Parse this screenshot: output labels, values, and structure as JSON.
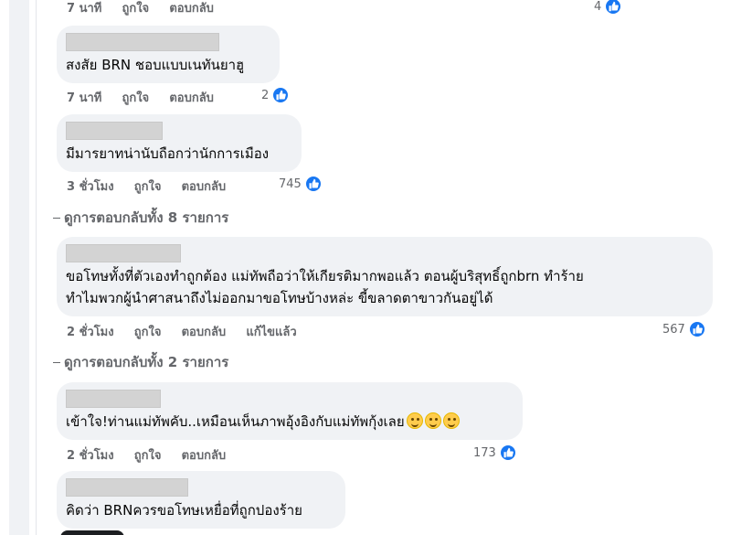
{
  "comments": [
    {
      "id": "c0",
      "text": "",
      "actions": {
        "time": "7 นาที",
        "like": "ถูกใจ",
        "reply": "ตอบกลับ",
        "edited": ""
      },
      "likes": "4"
    },
    {
      "id": "c1",
      "text": "สงสัย BRN ชอบแบบเนทันยาฮู",
      "actions": {
        "time": "7 นาที",
        "like": "ถูกใจ",
        "reply": "ตอบกลับ",
        "edited": ""
      },
      "likes": "2"
    },
    {
      "id": "c2",
      "text": "มีมารยาทน่านับถือกว่านักการเมือง",
      "actions": {
        "time": "3 ชั่วโมง",
        "like": "ถูกใจ",
        "reply": "ตอบกลับ",
        "edited": ""
      },
      "likes": "745",
      "view_replies": "ดูการตอบกลับทั้ง 8 รายการ"
    },
    {
      "id": "c3",
      "text_line1": "ขอโทษทั้งที่ตัวเองทำถูกต้อง แม่ทัพถือว่าให้เกียรติมากพอแล้ว ตอนผู้บริสุทธิ์ถูกbrn ทำร้าย",
      "text_line2": "ทำไมพวกผู้นำศาสนาถึงไม่ออกมาขอโทษบ้างหล่ะ ขี้ขลาดตาขาวกันอยู่ได้",
      "actions": {
        "time": "2 ชั่วโมง",
        "like": "ถูกใจ",
        "reply": "ตอบกลับ",
        "edited": "แก้ไขแล้ว"
      },
      "likes": "567",
      "view_replies": "ดูการตอบกลับทั้ง 2 รายการ"
    },
    {
      "id": "c4",
      "text": "เข้าใจ!ท่านแม่ทัพคับ..เหมือนเห็นภาพอุ้งอิงกับแม่ทัพกุ้งเลย",
      "emoji": "smiling-face-icon",
      "actions": {
        "time": "2 ชั่วโมง",
        "like": "ถูกใจ",
        "reply": "ตอบกลับ",
        "edited": ""
      },
      "likes": "173"
    },
    {
      "id": "c5",
      "text": "คิดว่า BRNควรขอโทษเหยื่อที่ถูกปองร้าย"
    }
  ],
  "colors": {
    "bubble": "#f0f2f5",
    "meta_text": "#65676b",
    "like_blue": "#1877f2",
    "name_redaction": "#d3d3d3"
  },
  "icons": {
    "like": "thumbs-up-icon",
    "emoji": "smiling-face-icon"
  }
}
